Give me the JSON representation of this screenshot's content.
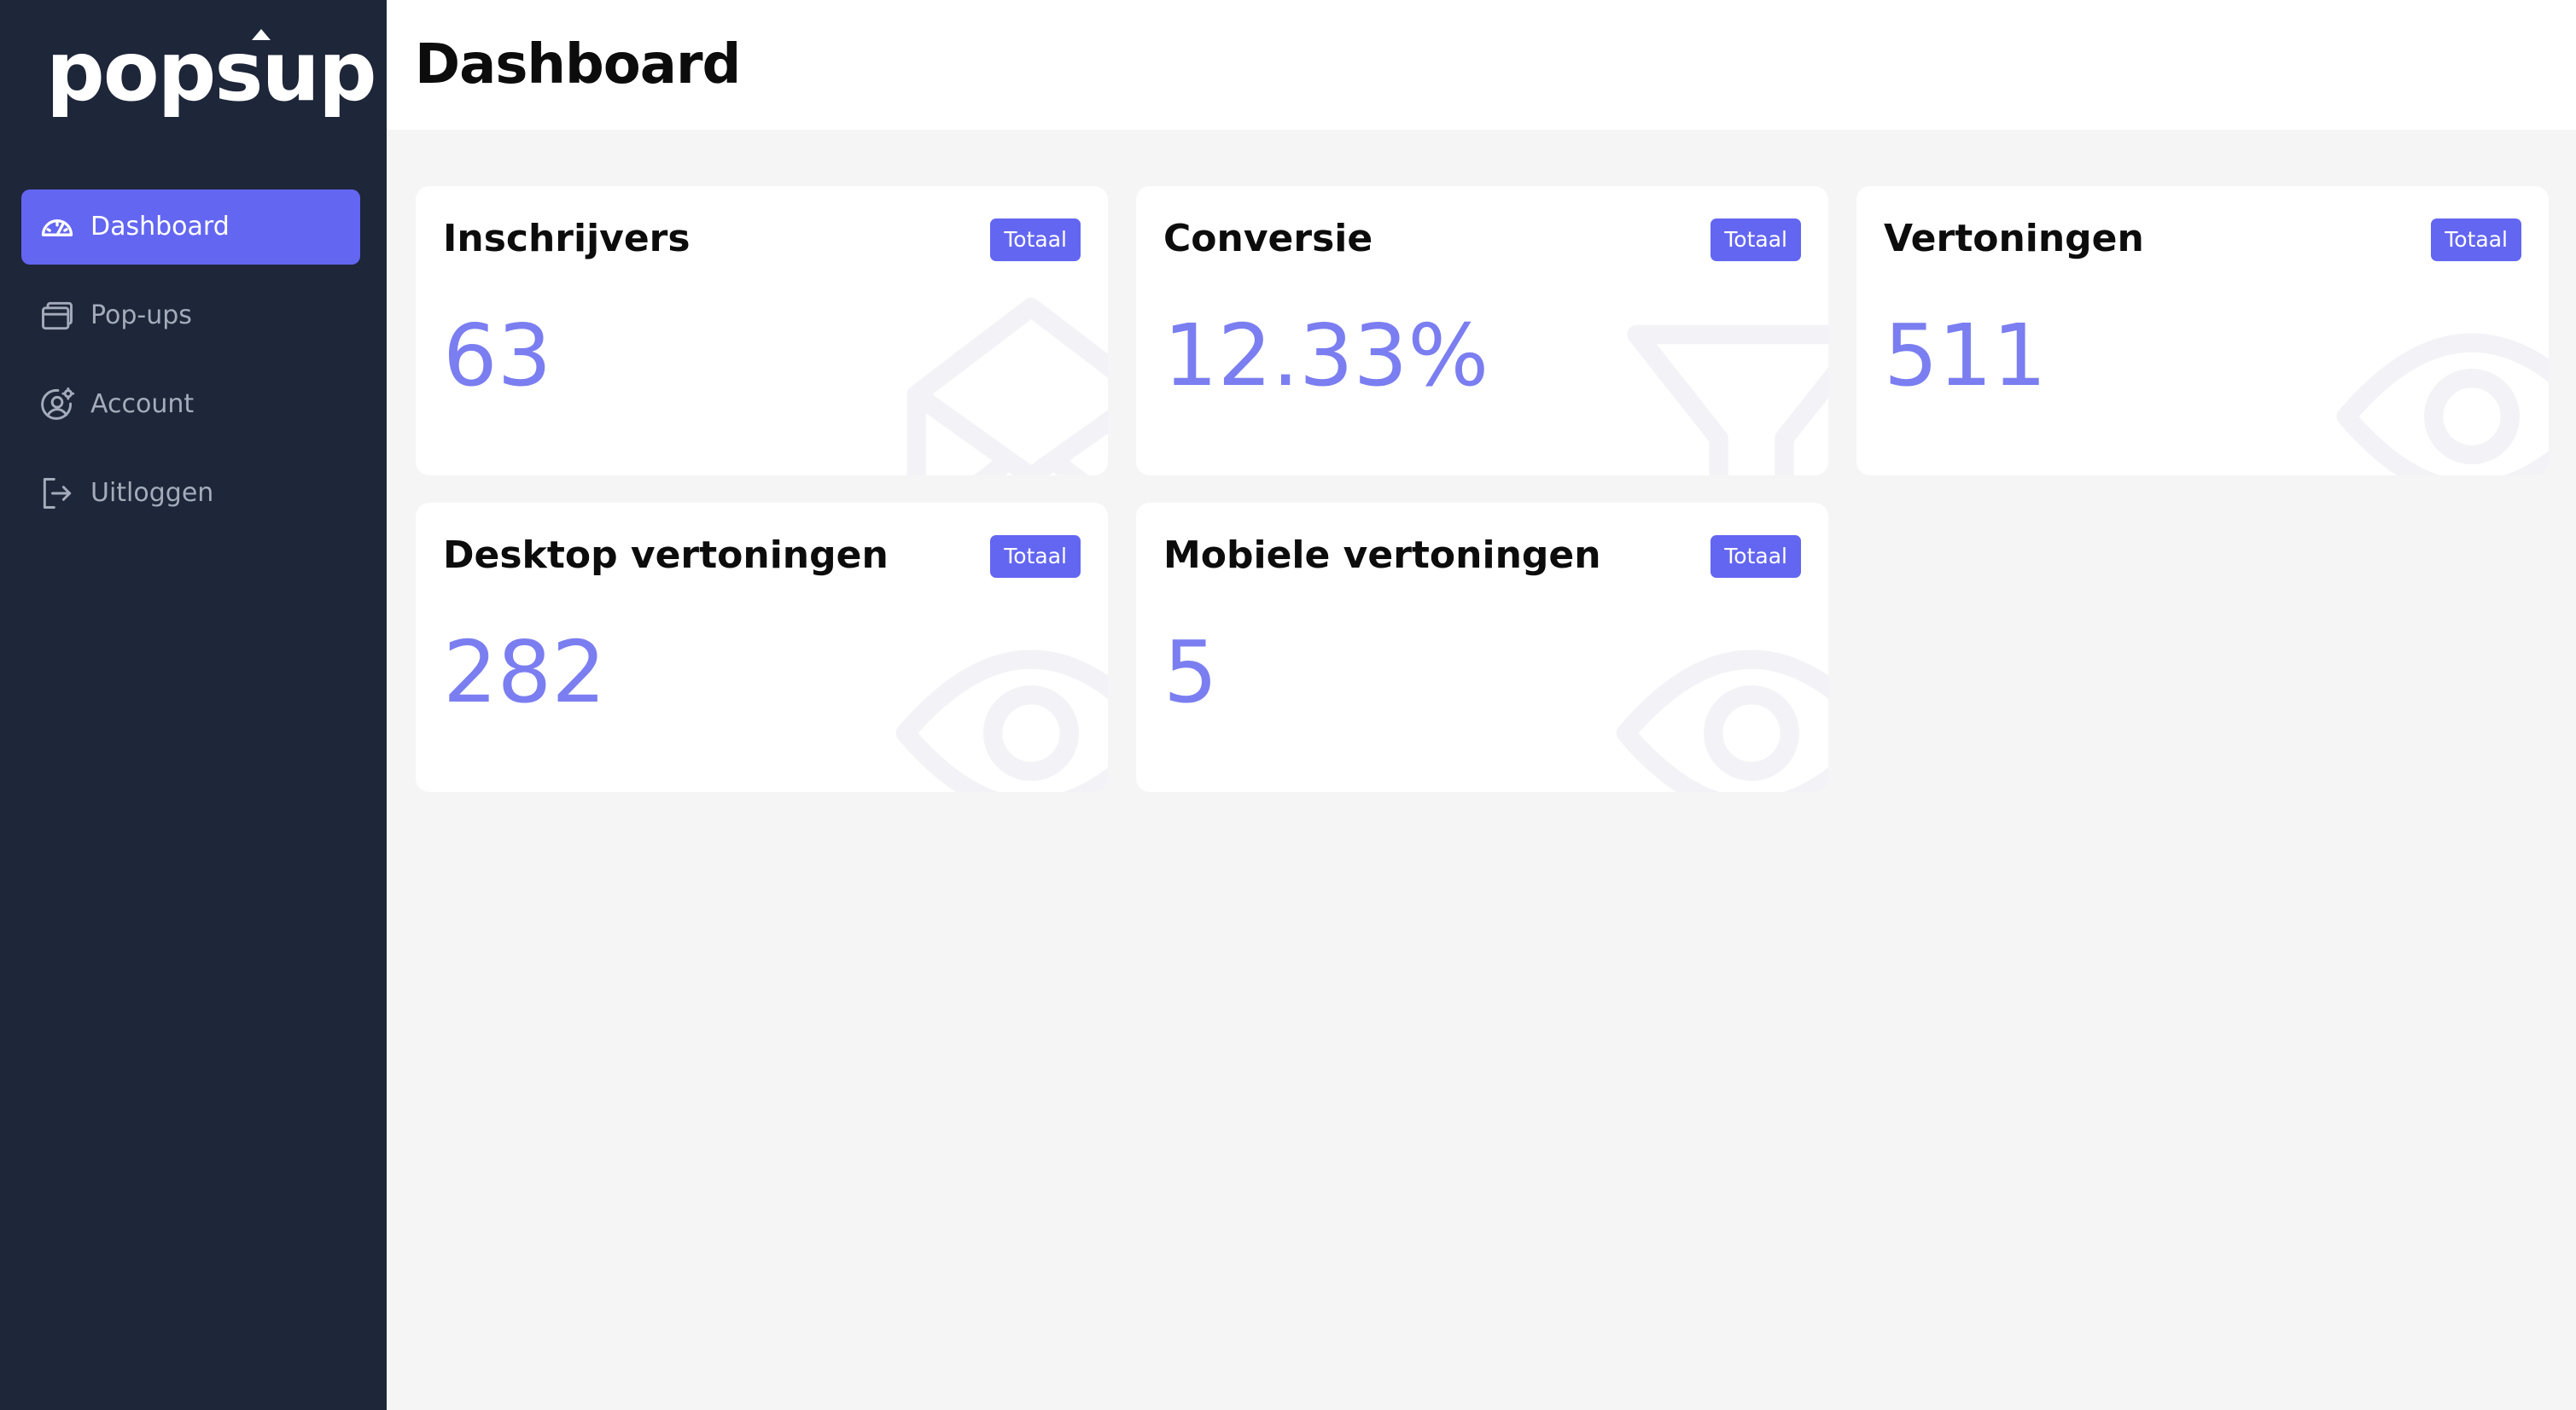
{
  "brand": {
    "name": "popsup"
  },
  "nav": {
    "items": [
      {
        "label": "Dashboard",
        "icon": "gauge-icon",
        "active": true
      },
      {
        "label": "Pop-ups",
        "icon": "windows-icon",
        "active": false
      },
      {
        "label": "Account",
        "icon": "user-settings-icon",
        "active": false
      },
      {
        "label": "Uitloggen",
        "icon": "logout-icon",
        "active": false
      }
    ]
  },
  "header": {
    "title": "Dashboard"
  },
  "cards": [
    {
      "title": "Inschrijvers",
      "badge": "Totaal",
      "value": "63",
      "icon": "envelope-icon"
    },
    {
      "title": "Conversie",
      "badge": "Totaal",
      "value": "12.33%",
      "icon": "funnel-icon"
    },
    {
      "title": "Vertoningen",
      "badge": "Totaal",
      "value": "511",
      "icon": "eye-icon"
    },
    {
      "title": "Desktop vertoningen",
      "badge": "Totaal",
      "value": "282",
      "icon": "eye-icon"
    },
    {
      "title": "Mobiele vertoningen",
      "badge": "Totaal",
      "value": "5",
      "icon": "eye-icon"
    }
  ],
  "colors": {
    "sidebar_bg": "#1e2639",
    "accent": "#6366f1",
    "value_text": "#7b7ef0",
    "page_bg": "#f5f5f5",
    "nav_text": "#a4abba"
  }
}
